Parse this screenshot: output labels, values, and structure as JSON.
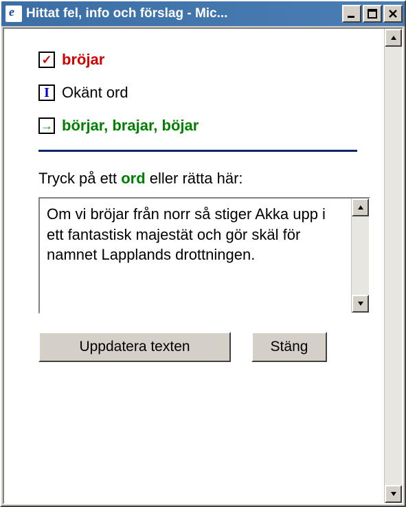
{
  "window": {
    "title": "Hittat fel, info och förslag - Mic..."
  },
  "error": {
    "word": "bröjar",
    "info": "Okänt ord",
    "suggestions": "börjar, brajar, böjar"
  },
  "instruction": {
    "prefix": "Tryck på ett ",
    "keyword": "ord",
    "suffix": " eller rätta här:"
  },
  "textarea": {
    "value": "Om vi bröjar från norr så stiger Akka upp i ett fantastisk majestät och gör skäl för namnet Lapplands drottningen."
  },
  "buttons": {
    "update": "Uppdatera texten",
    "close": "Stäng"
  }
}
